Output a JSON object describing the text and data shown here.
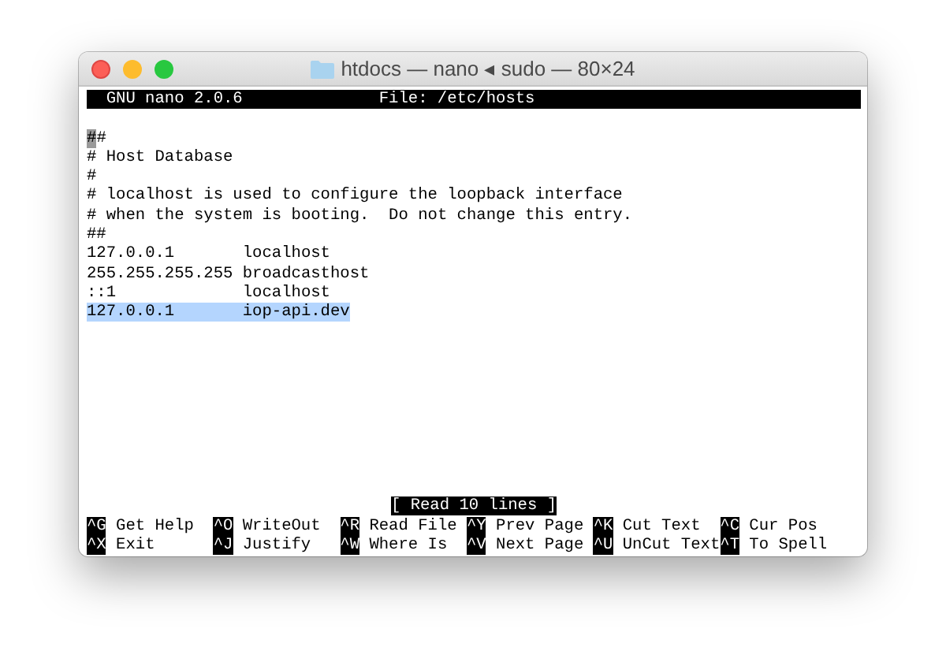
{
  "window": {
    "title": "htdocs — nano ◂ sudo — 80×24"
  },
  "header": {
    "version": "GNU nano 2.0.6",
    "file": "File: /etc/hosts"
  },
  "lines": [
    {
      "text": "##",
      "selected": false,
      "cursor": true
    },
    {
      "text": "# Host Database",
      "selected": false,
      "cursor": false
    },
    {
      "text": "#",
      "selected": false,
      "cursor": false
    },
    {
      "text": "# localhost is used to configure the loopback interface",
      "selected": false,
      "cursor": false
    },
    {
      "text": "# when the system is booting.  Do not change this entry.",
      "selected": false,
      "cursor": false
    },
    {
      "text": "##",
      "selected": false,
      "cursor": false
    },
    {
      "text": "127.0.0.1       localhost",
      "selected": false,
      "cursor": false
    },
    {
      "text": "255.255.255.255 broadcasthost",
      "selected": false,
      "cursor": false
    },
    {
      "text": "::1             localhost",
      "selected": false,
      "cursor": false
    },
    {
      "text": "127.0.0.1       iop-api.dev",
      "selected": true,
      "cursor": false
    }
  ],
  "status": "[ Read 10 lines ]",
  "shortcuts": [
    [
      {
        "key": "^G",
        "label": "Get Help"
      },
      {
        "key": "^O",
        "label": "WriteOut"
      },
      {
        "key": "^R",
        "label": "Read File"
      },
      {
        "key": "^Y",
        "label": "Prev Page"
      },
      {
        "key": "^K",
        "label": "Cut Text"
      },
      {
        "key": "^C",
        "label": "Cur Pos"
      }
    ],
    [
      {
        "key": "^X",
        "label": "Exit"
      },
      {
        "key": "^J",
        "label": "Justify"
      },
      {
        "key": "^W",
        "label": "Where Is"
      },
      {
        "key": "^V",
        "label": "Next Page"
      },
      {
        "key": "^U",
        "label": "UnCut Text"
      },
      {
        "key": "^T",
        "label": "To Spell"
      }
    ]
  ]
}
